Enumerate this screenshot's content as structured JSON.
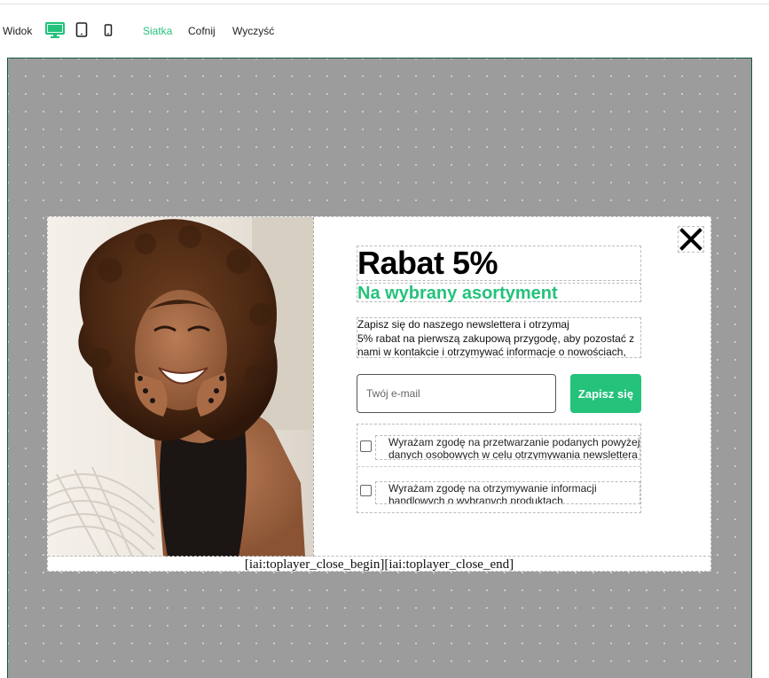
{
  "toolbar": {
    "view_label": "Widok",
    "icons": [
      "desktop-icon",
      "tablet-icon",
      "phone-icon"
    ],
    "grid_label": "Siatka",
    "undo_label": "Cofnij",
    "clear_label": "Wyczyść",
    "accent_color": "#24c27b"
  },
  "popup": {
    "title": "Rabat 5%",
    "subtitle": "Na wybrany asortyment",
    "description_lines": [
      "Zapisz się do naszego newslettera i otrzymaj",
      "5% rabat na pierwszą zakupową przygodę, aby pozostać z",
      "nami w kontakcie i otrzymywać informacje o nowościach,"
    ],
    "email_placeholder": "Twój e-mail",
    "submit_label": "Zapisz się",
    "consents": [
      {
        "lines": [
          "Wyrażam zgodę na przetwarzanie podanych powyżej",
          "danych osobowych w celu otrzymywania newslettera"
        ],
        "checked": false
      },
      {
        "lines": [
          "Wyrażam zgodę na otrzymywanie informacji",
          "handlowych o wybranych produktach."
        ],
        "checked": false
      }
    ],
    "footer_placeholder": "[iai:toplayer_close_begin][iai:toplayer_close_end]",
    "close_icon": "close-icon",
    "accent_color": "#24c27b"
  }
}
